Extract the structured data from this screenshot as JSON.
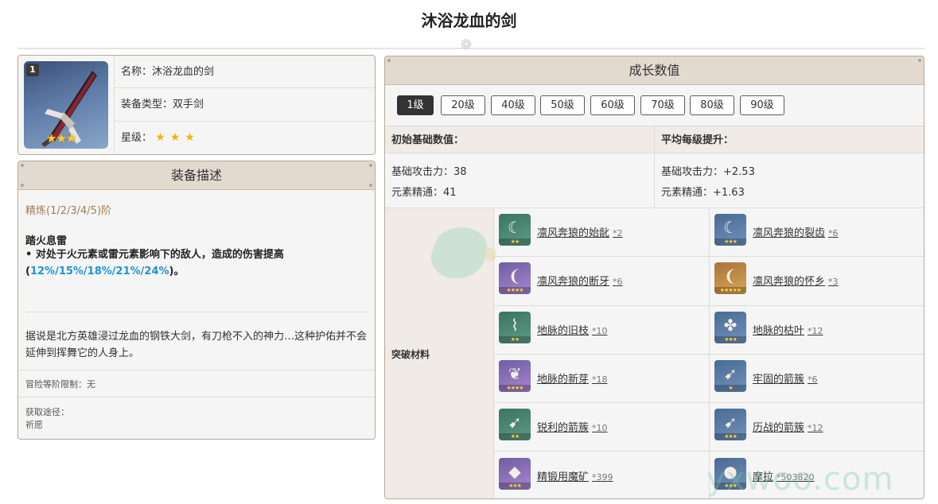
{
  "page": {
    "title": "沐浴龙血的剑"
  },
  "weapon": {
    "refine_badge": "1",
    "image_stars": "★★★",
    "name_row": "名称：沐浴龙血的剑",
    "type_row": "装备类型：双手剑",
    "rarity_label": "星级：",
    "rarity_stars": "★",
    "rarity": 3
  },
  "description": {
    "header": "装备描述",
    "refine": "精炼(1/2/3/4/5)阶",
    "skill_name": "踏火息雷",
    "skill_bullet": "• 对处于火元素或雷元素影响下的敌人，造成的伤害提高(",
    "skill_values": "12%/15%/18%/21%/24%",
    "skill_tail": ")。",
    "lore": "据说是北方英雄浸过龙血的钢铁大剑，有刀枪不入的神力…这种护佑并不会延伸到挥舞它的人身上。",
    "limit": "冒险等阶限制：无",
    "source_label": "获取途径：",
    "source_value": "祈愿"
  },
  "growth": {
    "header": "成长数值",
    "levels": [
      "1级",
      "20级",
      "40级",
      "50级",
      "60级",
      "70级",
      "80级",
      "90级"
    ],
    "active_level": "1级",
    "base_header": "初始基础数值：",
    "avg_header": "平均每级提升：",
    "base_stats": [
      "基础攻击力：38",
      "元素精通：41"
    ],
    "avg_stats": [
      "基础攻击力：+2.53",
      "元素精通：+1.63"
    ],
    "materials_label": "突破材料",
    "materials": [
      {
        "name": "凛风奔狼的始龀",
        "count": "*2",
        "stars": "★★",
        "quality": "green",
        "icon": "tooth-icon"
      },
      {
        "name": "凛风奔狼的裂齿",
        "count": "*6",
        "stars": "★★★",
        "quality": "blue",
        "icon": "tooth-icon"
      },
      {
        "name": "凛风奔狼的断牙",
        "count": "*6",
        "stars": "★★★★",
        "quality": "purple",
        "icon": "fang-icon"
      },
      {
        "name": "凛风奔狼的怀乡",
        "count": "*3",
        "stars": "★★★★★",
        "quality": "gold",
        "icon": "fang-icon"
      },
      {
        "name": "地脉的旧枝",
        "count": "*10",
        "stars": "★★",
        "quality": "green",
        "icon": "branch-icon"
      },
      {
        "name": "地脉的枯叶",
        "count": "*12",
        "stars": "★★★",
        "quality": "blue",
        "icon": "leaf-icon"
      },
      {
        "name": "地脉的新芽",
        "count": "*18",
        "stars": "★★★★",
        "quality": "purple",
        "icon": "sprout-icon"
      },
      {
        "name": "牢固的箭簇",
        "count": "*6",
        "stars": "★",
        "quality": "blue",
        "icon": "arrowhead-icon"
      },
      {
        "name": "锐利的箭簇",
        "count": "*10",
        "stars": "★★",
        "quality": "green",
        "icon": "arrowhead-icon"
      },
      {
        "name": "历战的箭簇",
        "count": "*12",
        "stars": "★★★",
        "quality": "blue",
        "icon": "arrowhead-icon"
      },
      {
        "name": "精锻用魔矿",
        "count": "*399",
        "stars": "★★★",
        "quality": "purple",
        "icon": "ore-icon"
      },
      {
        "name": "摩拉",
        "count": "*503820",
        "stars": "★★★",
        "quality": "blue",
        "icon": "mora-icon"
      }
    ]
  },
  "watermark": {
    "text": "yxwoo.com"
  },
  "colors": {
    "accent_blue": "#1b94d4",
    "header_bg": "#e2d9cf",
    "border": "#b7a89a",
    "refine_brown": "#a37b58"
  }
}
